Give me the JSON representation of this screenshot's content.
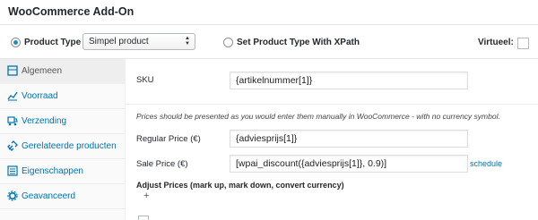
{
  "header": {
    "title": "WooCommerce Add-On"
  },
  "product_type": {
    "radio_label": "Product Type",
    "select_value": "Simpel product",
    "xpath_label": "Set Product Type With XPath",
    "virtual_label": "Virtueel:"
  },
  "sidebar": {
    "items": [
      {
        "label": "Algemeen",
        "icon": "wrench-icon"
      },
      {
        "label": "Voorraad",
        "icon": "chart-icon"
      },
      {
        "label": "Verzending",
        "icon": "truck-icon"
      },
      {
        "label": "Gerelateerde producten",
        "icon": "link-icon"
      },
      {
        "label": "Eigenschappen",
        "icon": "list-icon"
      },
      {
        "label": "Geavanceerd",
        "icon": "gear-icon"
      }
    ]
  },
  "general": {
    "sku_label": "SKU",
    "sku_value": "{artikelnummer[1]}",
    "note": "Prices should be presented as you would enter them manually in WooCommerce - with no currency symbol.",
    "regular_price_label": "Regular Price (€)",
    "regular_price_value": "{adviesprijs[1]}",
    "sale_price_label": "Sale Price (€)",
    "sale_price_value": "[wpai_discount({adviesprijs[1]}, 0.9)]",
    "schedule_link": "schedule",
    "adjust_prices_label": "Adjust Prices (mark up, mark down, convert currency)",
    "adjust_prices_toggle": "+"
  },
  "colors": {
    "accent": "#0073aa",
    "radio": "#1e8cbe"
  }
}
